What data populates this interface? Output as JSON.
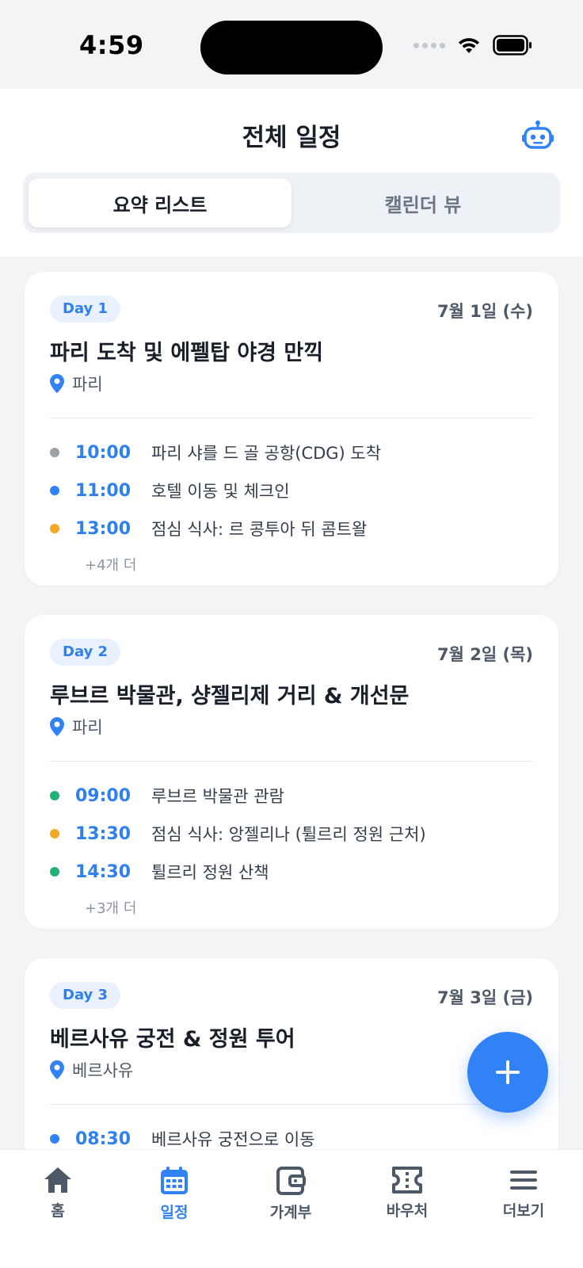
{
  "status_bar": {
    "time": "4:59"
  },
  "header": {
    "title": "전체 일정",
    "segments": [
      "요약 리스트",
      "캘린더 뷰"
    ],
    "active_segment": "요약 리스트"
  },
  "days": [
    {
      "badge": "Day 1",
      "date": "7월 1일 (수)",
      "title": "파리 도착 및 에펠탑 야경 만끽",
      "location": "파리",
      "events": [
        {
          "time": "10:00",
          "name": "파리 샤를 드 골 공항(CDG) 도착",
          "dot_color": "#9aa0a6"
        },
        {
          "time": "11:00",
          "name": "호텔 이동 및 체크인",
          "dot_color": "#3182f6"
        },
        {
          "time": "13:00",
          "name": "점심 식사: 르 콩투아 뒤 콤트왈",
          "dot_color": "#f5a623"
        }
      ],
      "more": "+4개 더"
    },
    {
      "badge": "Day 2",
      "date": "7월 2일 (목)",
      "title": "루브르 박물관, 샹젤리제 거리 & 개선문",
      "location": "파리",
      "events": [
        {
          "time": "09:00",
          "name": "루브르 박물관 관람",
          "dot_color": "#20b07a"
        },
        {
          "time": "13:30",
          "name": "점심 식사: 앙젤리나 (튈르리 정원 근처)",
          "dot_color": "#f5a623"
        },
        {
          "time": "14:30",
          "name": "튈르리 정원 산책",
          "dot_color": "#20b07a"
        }
      ],
      "more": "+3개 더"
    },
    {
      "badge": "Day 3",
      "date": "7월 3일 (금)",
      "title": "베르사유 궁전 & 정원 투어",
      "location": "베르사유",
      "events": [
        {
          "time": "08:30",
          "name": "베르사유 궁전으로 이동",
          "dot_color": "#3182f6"
        }
      ],
      "more": ""
    }
  ],
  "tabbar": {
    "items": [
      {
        "label": "홈",
        "icon": "home-icon"
      },
      {
        "label": "일정",
        "icon": "calendar-icon"
      },
      {
        "label": "가계부",
        "icon": "wallet-icon"
      },
      {
        "label": "바우처",
        "icon": "ticket-icon"
      },
      {
        "label": "더보기",
        "icon": "menu-icon"
      }
    ],
    "active": "일정"
  },
  "colors": {
    "accent": "#3182f6",
    "badge_bg": "#e8f1fd",
    "time_text": "#2f80ed"
  }
}
